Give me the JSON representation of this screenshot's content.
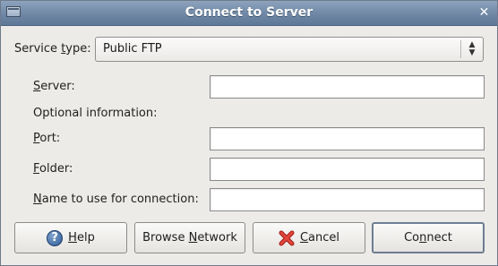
{
  "window": {
    "title": "Connect to Server",
    "close_glyph": "✕"
  },
  "service_type": {
    "label_pre": "Service ",
    "label_mn": "t",
    "label_post": "ype:",
    "value": "Public FTP"
  },
  "fields": {
    "server": {
      "label_mn": "S",
      "label_post": "erver:",
      "value": ""
    },
    "optional": {
      "label": "Optional information:"
    },
    "port": {
      "label_mn": "P",
      "label_post": "ort:",
      "value": ""
    },
    "folder": {
      "label_mn": "F",
      "label_post": "older:",
      "value": ""
    },
    "name": {
      "label_mn": "N",
      "label_post": "ame to use for connection:",
      "value": ""
    }
  },
  "buttons": {
    "help": {
      "mn": "H",
      "post": "elp",
      "icon": "help-icon"
    },
    "browse": {
      "pre": "Browse ",
      "mn": "N",
      "post": "etwork"
    },
    "cancel": {
      "mn": "C",
      "post": "ancel",
      "icon": "cancel-icon"
    },
    "connect": {
      "pre": "Co",
      "mn": "n",
      "post": "nect"
    }
  },
  "colors": {
    "titlebar": "#6f87a5",
    "window_bg": "#edebe8",
    "cancel_icon": "#d9302a",
    "help_icon": "#2c5a95"
  }
}
